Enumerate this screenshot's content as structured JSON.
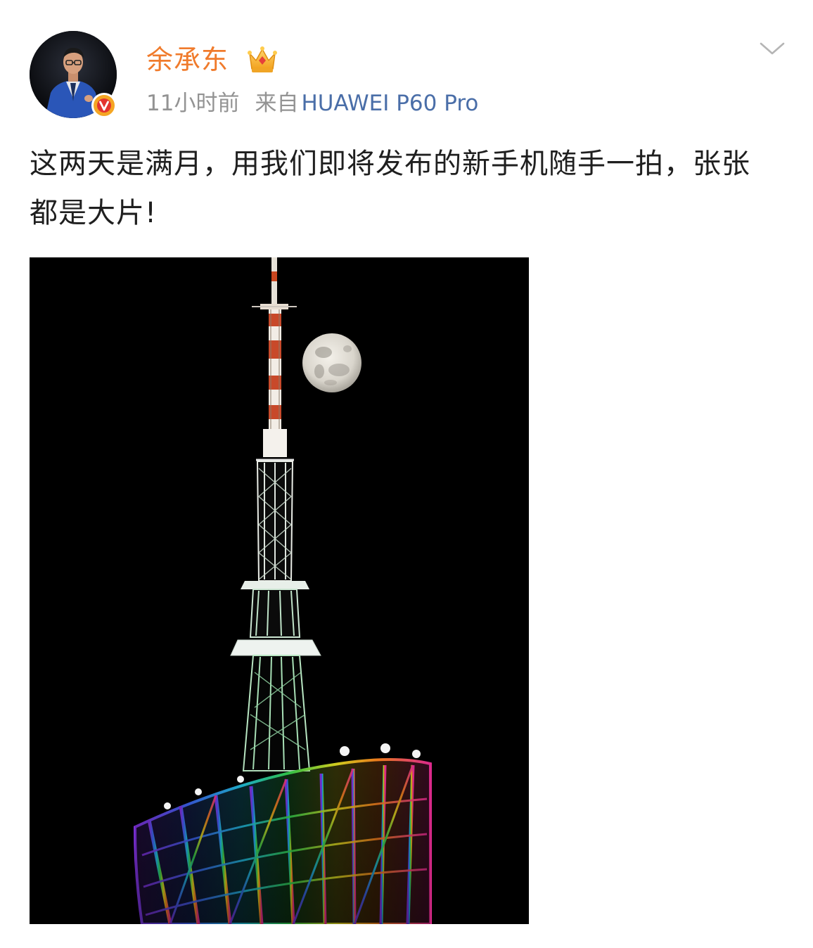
{
  "post": {
    "author": {
      "name": "余承东",
      "avatar_icon": "person-avatar",
      "verified_badge_icon": "verified-v-icon",
      "vip_badge_icon": "crown-icon"
    },
    "timestamp": "11小时前",
    "source_prefix": "来自",
    "source_device": "HUAWEI P60 Pro",
    "text": "这两天是满月，用我们即将发布的新手机随手一拍，张张都是大片!",
    "menu_icon": "chevron-down-icon",
    "image": {
      "subject": "full-moon-beside-illuminated-tower"
    }
  },
  "colors": {
    "username": "#f07b2c",
    "meta_gray": "#939393",
    "device_link": "#4a6ea8",
    "text": "#1f1f1f",
    "badge": "#f5a623"
  }
}
